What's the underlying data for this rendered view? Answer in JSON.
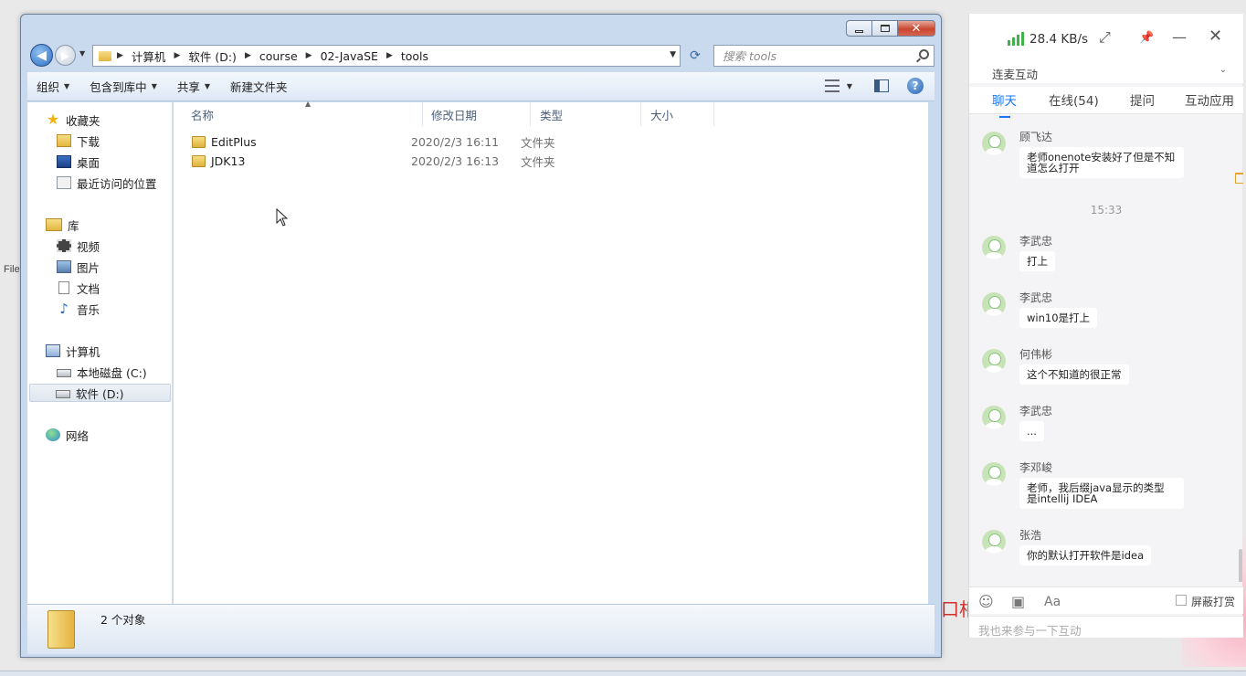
{
  "desktop": {
    "file_fragment": "File",
    "red_fragment": "口相"
  },
  "explorer": {
    "path": [
      "计算机",
      "软件 (D:)",
      "course",
      "02-JavaSE",
      "tools"
    ],
    "search_placeholder": "搜索 tools",
    "toolbar": {
      "organize": "组织",
      "include_library": "包含到库中",
      "share": "共享",
      "new_folder": "新建文件夹"
    },
    "nav": {
      "favorites": "收藏夹",
      "downloads": "下载",
      "desktop": "桌面",
      "recent": "最近访问的位置",
      "libraries": "库",
      "videos": "视频",
      "pictures": "图片",
      "documents": "文档",
      "music": "音乐",
      "computer": "计算机",
      "local_c": "本地磁盘 (C:)",
      "soft_d": "软件 (D:)",
      "network": "网络"
    },
    "columns": {
      "name": "名称",
      "modified": "修改日期",
      "type": "类型",
      "size": "大小"
    },
    "files": [
      {
        "name": "EditPlus",
        "modified": "2020/2/3 16:11",
        "type": "文件夹"
      },
      {
        "name": "JDK13",
        "modified": "2020/2/3 16:13",
        "type": "文件夹"
      }
    ],
    "status": "2 个对象"
  },
  "chat": {
    "speed": "28.4 KB/s",
    "section": "连麦互动",
    "tabs": [
      "聊天",
      "在线(54)",
      "提问",
      "互动应用"
    ],
    "messages": [
      {
        "name": "顾飞达",
        "text_line1": "老师onenote安装好了但是不知",
        "text_line2": "道怎么打开"
      },
      {
        "time": "15:33"
      },
      {
        "name": "李武忠",
        "text_line1": "打上"
      },
      {
        "name": "李武忠",
        "text_line1": "win10是打上"
      },
      {
        "name": "何伟彬",
        "text_line1": "这个不知道的很正常"
      },
      {
        "name": "李武忠",
        "text_line1": "..."
      },
      {
        "name": "李邓峻",
        "text_line1": "老师，我后缀java显示的类型",
        "text_line2": "是intellij IDEA"
      },
      {
        "name": "张浩",
        "text_line1": "你的默认打开软件是idea"
      }
    ],
    "block_tips": "屏蔽打赏",
    "input_placeholder": "我也来参与一下互动"
  }
}
